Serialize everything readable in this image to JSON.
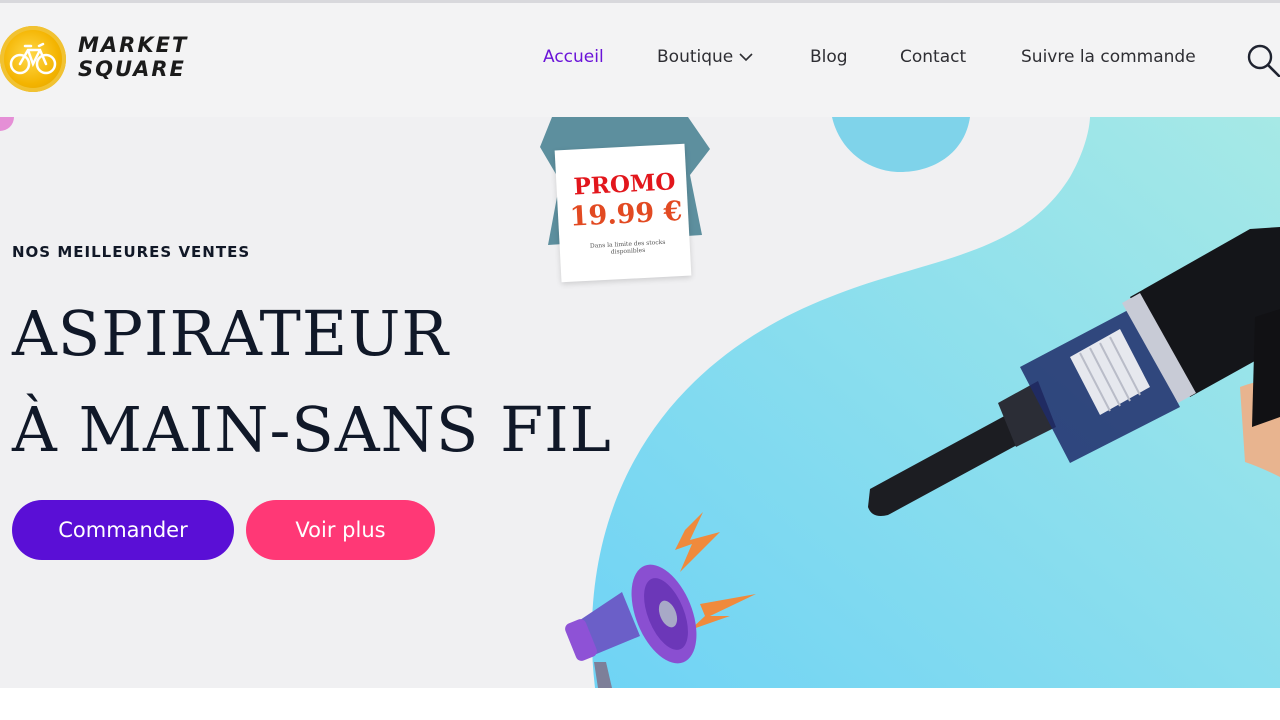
{
  "brand": {
    "line1": "MARKET",
    "line2": "SQUARE",
    "logo_icon": "bicycle-icon",
    "colors": {
      "gold": "#f4b400"
    }
  },
  "nav": {
    "items": [
      {
        "label": "Accueil",
        "active": true
      },
      {
        "label": "Boutique",
        "has_dropdown": true
      },
      {
        "label": "Blog"
      },
      {
        "label": "Contact"
      },
      {
        "label": "Suivre la commande"
      }
    ],
    "search_icon": "search-icon",
    "active_color": "#6a13d8"
  },
  "hero": {
    "eyebrow": "NOS MEILLEURES VENTES",
    "title_line1": "ASPIRATEUR",
    "title_line2": "À MAIN-SANS FIL",
    "primary_button": "Commander",
    "secondary_button": "Voir plus",
    "colors": {
      "primary": "#5a0fd6",
      "secondary": "#ff3876",
      "blob": "#7fd8ee"
    },
    "promo": {
      "word": "PROMO",
      "price": "19.99 €",
      "note": "Dans la limite des stocks disponibles"
    },
    "illustrations": [
      "handheld-vacuum-image",
      "megaphone-icon",
      "lightning-icon"
    ]
  }
}
